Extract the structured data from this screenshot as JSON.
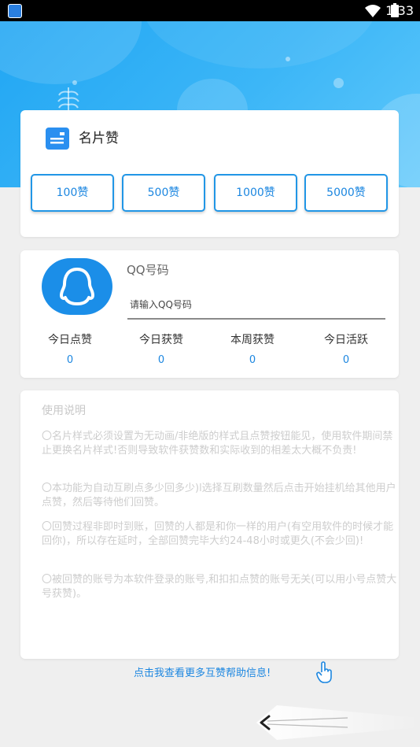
{
  "status_bar": {
    "time": "1:33"
  },
  "card_like": {
    "title": "名片赞",
    "options": [
      "100赞",
      "500赞",
      "1000赞",
      "5000赞"
    ]
  },
  "qq": {
    "label": "QQ号码",
    "placeholder": "请输入QQ号码",
    "stats": [
      {
        "label": "今日点赞",
        "value": "0"
      },
      {
        "label": "今日获赞",
        "value": "0"
      },
      {
        "label": "本周获赞",
        "value": "0"
      },
      {
        "label": "今日活跃",
        "value": "0"
      }
    ]
  },
  "instructions": {
    "heading": "使用说明",
    "items": [
      "〇名片样式必须设置为无动画/非绝版的样式且点赞按钮能见，使用软件期间禁止更换名片样式!否则导致软件获赞数和实际收到的相差太大概不负责!",
      "〇本功能为自动互刷点多少回多少)l选择互刷数量然后点击开始挂机给其他用户点赞，然后等待他们回赞。",
      "〇回赞过程非即时到账，回赞的人都是和你一样的用户(有空用软件的时候才能回你)，所以存在延时，全部回赞完毕大约24-48小时或更久(不会少回)!",
      "〇被回赞的账号为本软件登录的账号,和扣扣点赞的账号无关(可以用小号点赞大号获赞)。"
    ]
  },
  "help_link": "点击我查看更多互赞帮助信息!"
}
